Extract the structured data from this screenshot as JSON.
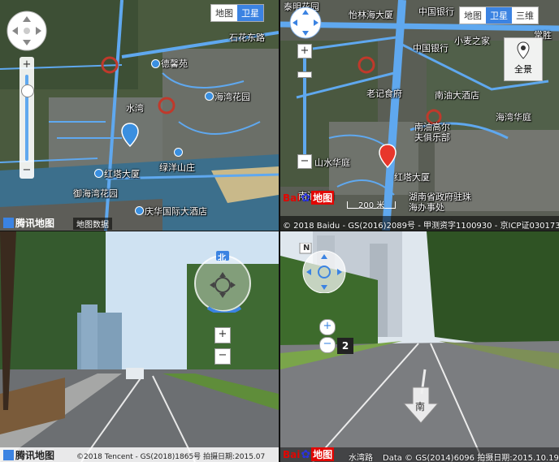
{
  "tencent_map": {
    "map_types": [
      "地图",
      "卫星"
    ],
    "active_type": "卫星",
    "labels": [
      "石花东路",
      "德馨苑",
      "海湾花园",
      "水湾",
      "红塔大厦",
      "御海湾花园",
      "绿洋山庄",
      "庆华国际大酒店"
    ],
    "logo": "腾讯地图",
    "badge": "地图数据"
  },
  "baidu_map": {
    "map_types": [
      "地图",
      "卫星",
      "三维"
    ],
    "active_type": "卫星",
    "labels": [
      "泰明花园",
      "怡林海大厦",
      "中国银行",
      "小麦之家",
      "常胜",
      "中国银行",
      "老记食府",
      "南油大酒店",
      "海湾华庭",
      "南油高尔夫俱乐部",
      "山水华庭",
      "红塔大厦",
      "南油花园",
      "湖南省政府驻珠海办事处"
    ],
    "panorama_label": "全景",
    "scale_label": "200 米",
    "logo_bai": "Bai",
    "logo_du": "du",
    "logo_map": "地图",
    "copyright": "© 2018 Baidu - GS(2016)2089号 - 甲测资字1100930 - 京ICP证030173号"
  },
  "tencent_street": {
    "compass": "北",
    "logo": "腾讯地图",
    "copyright": "©2018 Tencent - GS(2018)1865号",
    "date": "拍摄日期:2015.07"
  },
  "baidu_street": {
    "compass": "N",
    "zoom_level": "2",
    "direction": "南",
    "logo_bai": "Bai",
    "logo_du": "du",
    "logo_map": "地图",
    "road": "水湾路",
    "copyright": "Data © GS(2014)6096 拍摄日期:2015.10.19"
  },
  "colors": {
    "accent": "#3b83e2",
    "baidu_red": "#e10602",
    "road_blue": "#5fa8ef",
    "marker_red": "#e8372c"
  }
}
